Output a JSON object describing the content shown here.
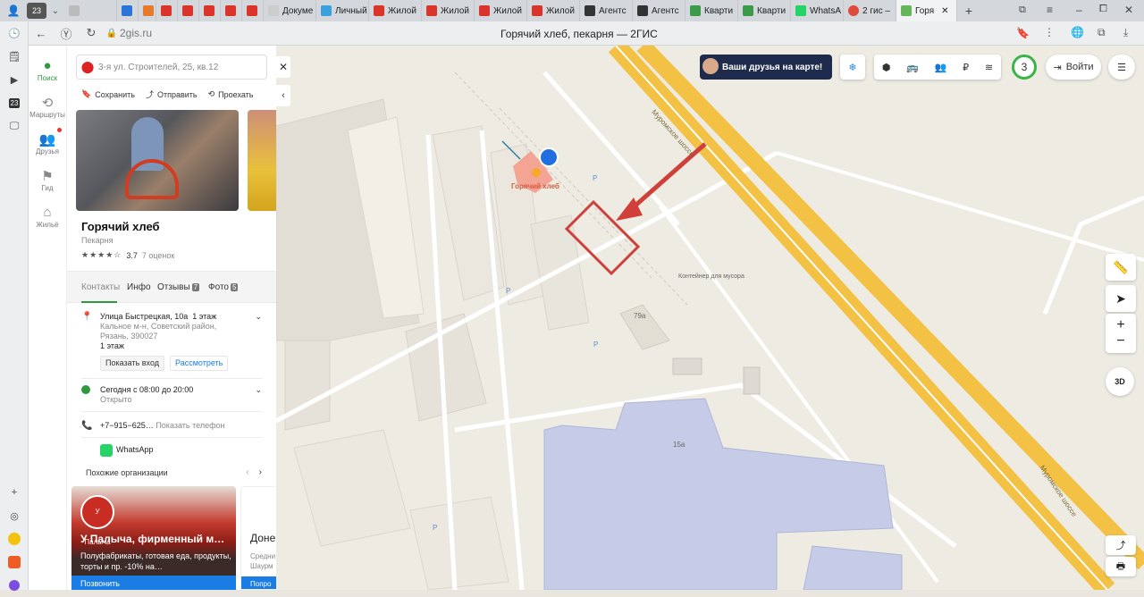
{
  "browser": {
    "tab_count": "23",
    "tabs": [
      "Докуме",
      "Личный",
      "Жилой",
      "Жилой",
      "Жилой",
      "Жилой",
      "Агентс",
      "Агентс",
      "Кварти",
      "Кварти",
      "WhatsA",
      "2 гис –",
      "Горя"
    ],
    "domain": "2gis.ru",
    "page_title": "Горячий хлеб, пекарня — 2ГИС",
    "sidebar_badge": "23"
  },
  "rail": [
    {
      "label": "Поиск",
      "icon": "search-pin-icon"
    },
    {
      "label": "Маршруты",
      "icon": "route-icon"
    },
    {
      "label": "Друзья",
      "icon": "friends-icon"
    },
    {
      "label": "Гид",
      "icon": "guide-flag-icon"
    },
    {
      "label": "Жильё",
      "icon": "housing-icon"
    }
  ],
  "panel": {
    "search_placeholder": "3-я ул. Строителей, 25, кв.12",
    "actions": {
      "save": "Сохранить",
      "share": "Отправить",
      "route": "Проехать"
    },
    "name": "Горячий хлеб",
    "type": "Пекарня",
    "rating_value": "3.7",
    "rating_count": "7 оценок",
    "tabs": {
      "contacts": "Контакты",
      "info": "Инфо",
      "reviews": "Отзывы",
      "reviews_count": "7",
      "photos": "Фото",
      "photos_count": "5"
    },
    "address": {
      "line1": "Улица Быстрецкая, 10а",
      "floor_inline": "1 этаж",
      "line2": "Кальное м-н, Советский район,",
      "line3": "Рязань, 390027",
      "floor": "1 этаж"
    },
    "address_buttons": {
      "entrance": "Показать вход",
      "review": "Рассмотреть"
    },
    "hours": {
      "line": "Сегодня с 08:00 до 20:00",
      "status": "Открыто"
    },
    "phone": {
      "number": "+7−915−625…",
      "show": "Показать телефон"
    },
    "whatsapp": "WhatsApp",
    "similar_title": "Похожие организации",
    "card1": {
      "title": "У Палыча, фирменный м…",
      "desc": "Полуфабрикаты, готовая еда, продукты, торты и пр. -10% на…",
      "button": "Позвонить",
      "logo": "У Палыча"
    },
    "card2": {
      "title": "Доне",
      "desc1": "Средни",
      "desc2": "Шаурм",
      "button": "Попро"
    }
  },
  "map": {
    "promo": "Ваши друзья на карте!",
    "counter": "3",
    "login": "Войти",
    "marker_label": "Горячий хлеб",
    "road_label1": "Муромское шоссе",
    "road_label2": "Муромское шоссе",
    "container_label": "Контейнер для мусора",
    "bld_79a": "79а",
    "bld_15a": "15а",
    "view_3d": "3D",
    "parking": "P"
  },
  "colors": {
    "accent_green": "#2e9a3f",
    "road_yellow": "#f3c143",
    "building_blue": "#c6cbe8",
    "highlight_red": "#d0403a",
    "link_blue": "#1a7ce5"
  }
}
